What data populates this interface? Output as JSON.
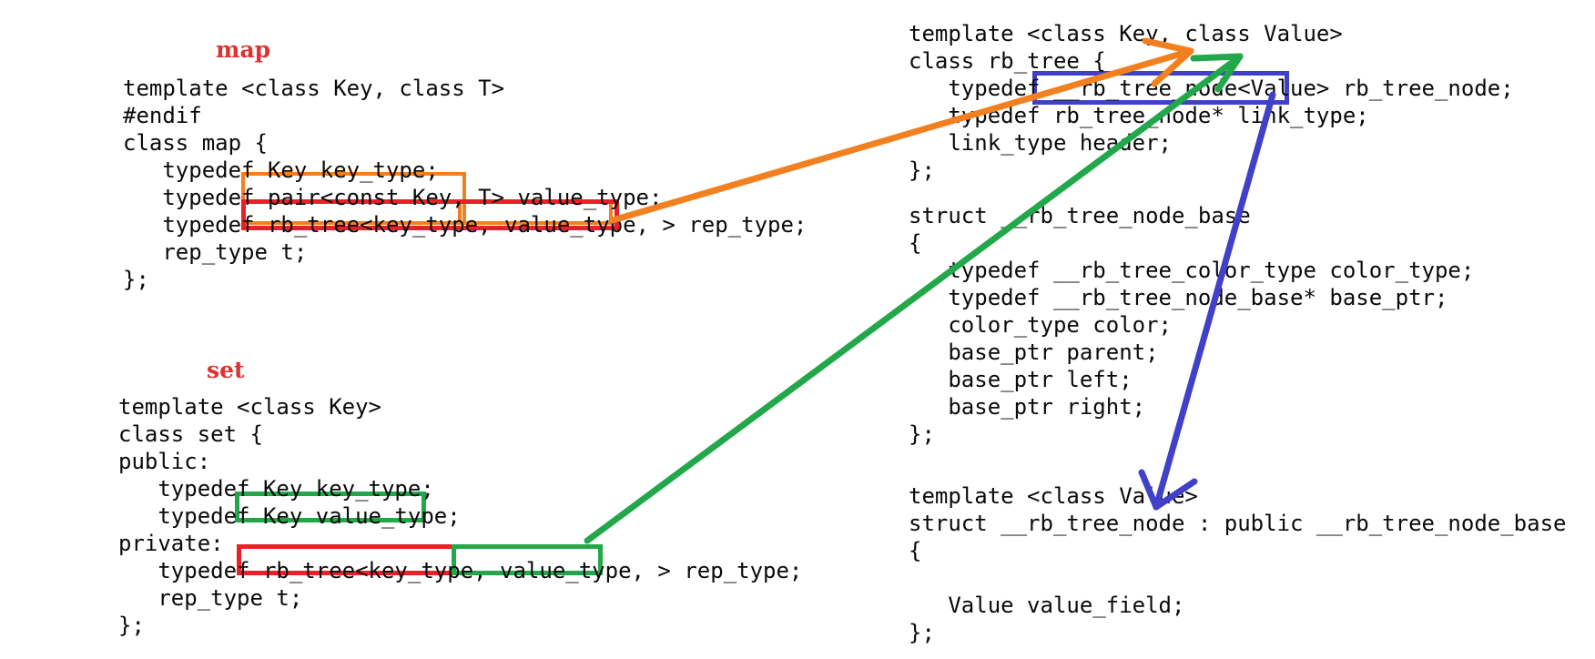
{
  "figure": {
    "kind": "annotated-source-code-diagram",
    "background_color": "#ffffff",
    "title_color": "#e03030",
    "text_color": "#0a0a0a"
  },
  "sections": {
    "map": {
      "title": "map",
      "lines": [
        "template <class Key, class T>",
        "#endif",
        "class map {",
        "   typedef Key key_type;",
        "   typedef pair<const Key, T> value_type;",
        "   typedef rb_tree<key_type, value_type, > rep_type;",
        "   rep_type t;",
        "};"
      ],
      "line_map": {
        "l1": "template <class Key, class T>",
        "l2": "#endif",
        "l3": "class map {",
        "l4": "   typedef Key key_type;",
        "l5": "   typedef pair<const Key, T> value_type;",
        "l6": "   typedef rb_tree<key_type, value_type, > rep_type;",
        "l7": "   rep_type t;",
        "l8": "};"
      }
    },
    "set": {
      "title": "set",
      "lines": [
        "template <class Key>",
        "class set {",
        "public:",
        "   typedef Key key_type;",
        "   typedef Key value_type;",
        "private:",
        "   typedef rb_tree<key_type, value_type, > rep_type;",
        "   rep_type t;",
        "};"
      ],
      "line_map": {
        "l1": "template <class Key>",
        "l2": "class set {",
        "l3": "public:",
        "l4": "   typedef Key key_type;",
        "l5": "   typedef Key value_type;",
        "l6": "private:",
        "l7": "   typedef rb_tree<key_type, value_type, > rep_type;",
        "l8": "   rep_type t;",
        "l9": "};"
      }
    },
    "rb_tree": {
      "line_map": {
        "l1": "template <class Key, class Value>",
        "l2": "class rb_tree {",
        "l3": "   typedef __rb_tree_node<Value> rb_tree_node;",
        "l4": "   typedef rb_tree_node* link_type;",
        "l5": "   link_type header;",
        "l6": "};"
      }
    },
    "rb_tree_node_base": {
      "line_map": {
        "l1": "struct __rb_tree_node_base",
        "l2": "{",
        "l3": "   typedef __rb_tree_color_type color_type;",
        "l4": "   typedef __rb_tree_node_base* base_ptr;",
        "l5": "   color_type color;",
        "l6": "   base_ptr parent;",
        "l7": "   base_ptr left;",
        "l8": "   base_ptr right;",
        "l9": "};"
      }
    },
    "rb_tree_node": {
      "line_map": {
        "l1": "template <class Value>",
        "l2": "struct __rb_tree_node : public __rb_tree_node_base",
        "l3": "{",
        "l4": "",
        "l5": "   Value value_field;",
        "l6": "};"
      }
    }
  },
  "highlights": {
    "map_orange_pair": {
      "label": "pair<const Key, T>",
      "color": "#f28020"
    },
    "map_red_rbtree": {
      "label": "rb_tree<key_type, value_type, >",
      "color": "#ea2027"
    },
    "map_orange_valuetype": {
      "label": "value_type,",
      "color": "#f28020"
    },
    "set_green_keyvalue": {
      "label": "Key value_type;",
      "color": "#22a84a"
    },
    "set_red_rbtree": {
      "label": "rb_tree<key_type, value_type, >",
      "color": "#ea2027"
    },
    "set_green_valuetype": {
      "label": "value_type, >",
      "color": "#22a84a"
    },
    "rbtree_blue_node": {
      "label": "__rb_tree_node<Value>",
      "color": "#4040c8"
    }
  },
  "arrows": [
    {
      "name": "orange-arrow",
      "color": "#f28020",
      "from": "map value_type template argument",
      "to": "rb_tree class Value template parameter"
    },
    {
      "name": "green-arrow",
      "color": "#22a84a",
      "from": "set value_type template argument",
      "to": "rb_tree class Value template parameter"
    },
    {
      "name": "blue-arrow",
      "color": "#4040c8",
      "from": "__rb_tree_node<Value> typedef",
      "to": "struct __rb_tree_node definition"
    }
  ]
}
